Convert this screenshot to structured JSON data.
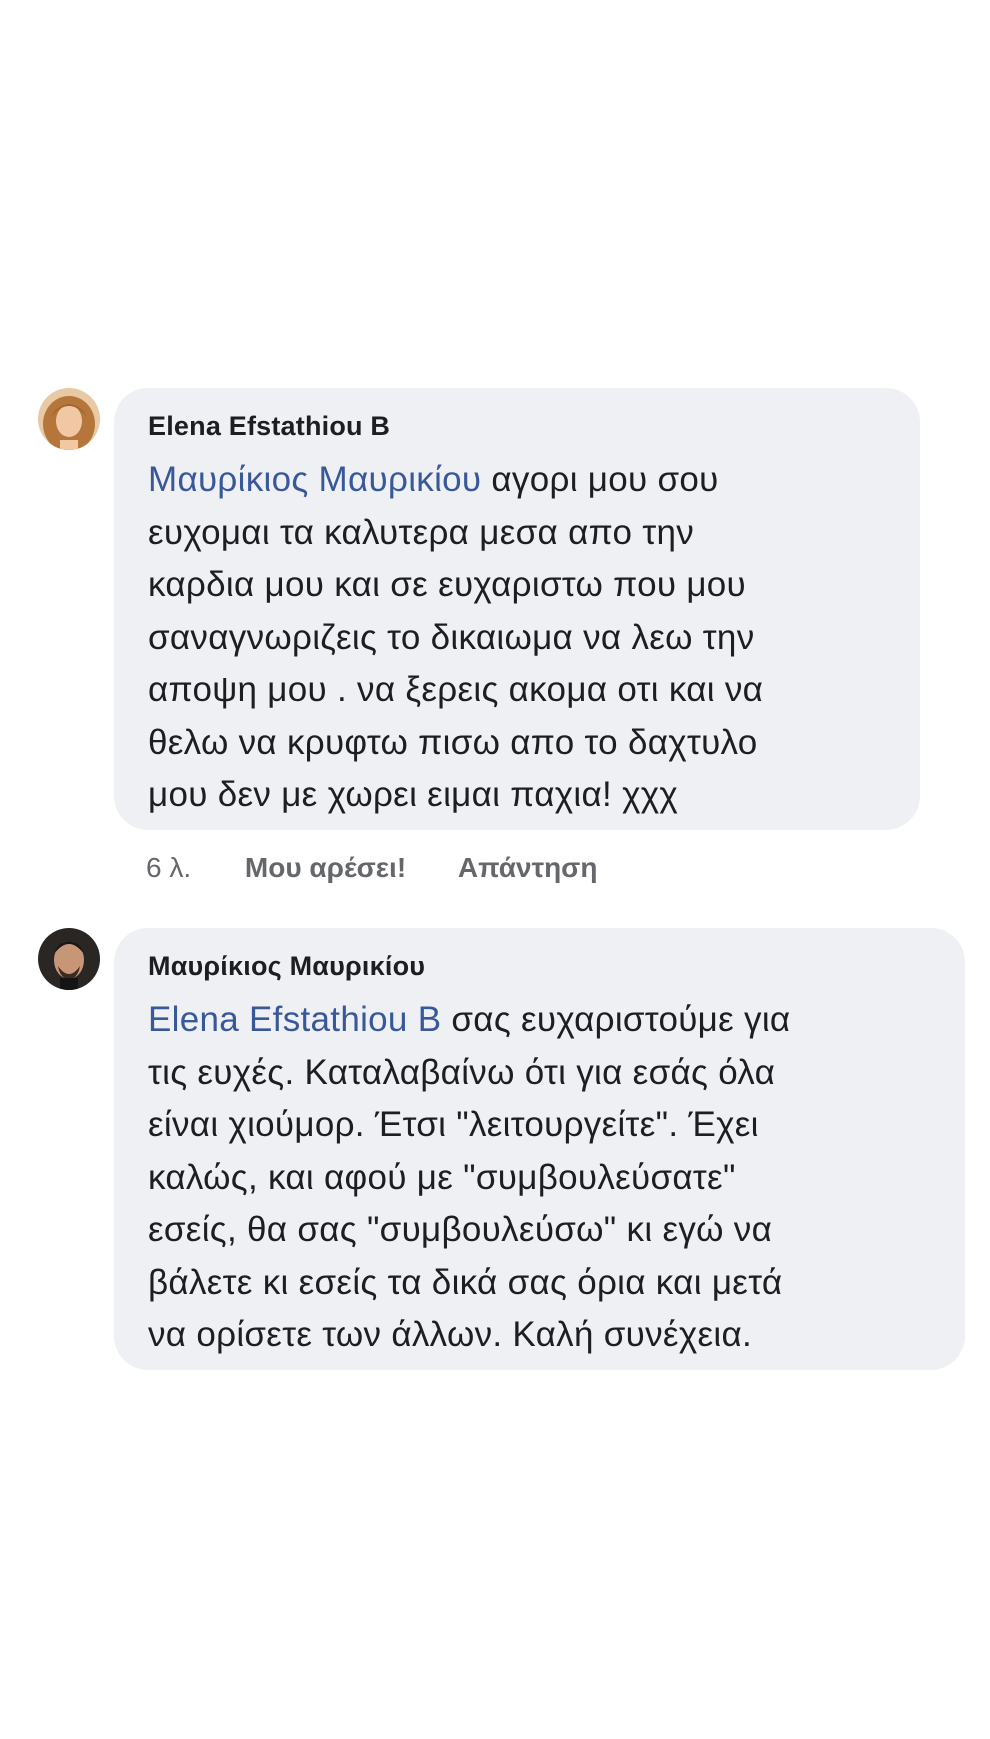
{
  "comments": [
    {
      "author": "Elena Efstathiou B",
      "mention": "Μαυρίκιος Μαυρικίου",
      "lines": [
        " αγορι μου σου",
        "ευχομαι τα καλυτερα μεσα απο την",
        "καρδια μου και σε ευχαριστω που μου",
        "σαναγνωριζεις το δικαιωμα να λεω την",
        "αποψη μου . να ξερεις ακομα οτι και να",
        "θελω να κρυφτω πισω απο το δαχτυλο",
        "μου δεν με χωρει ειμαι παχια! χχχ"
      ],
      "time": "6 λ.",
      "like_label": "Μου αρέσει!",
      "reply_label": "Απάντηση"
    },
    {
      "author": "Μαυρίκιος Μαυρικίου",
      "mention": "Elena Efstathiou B",
      "lines": [
        " σας ευχαριστούμε για",
        "τις ευχές. Καταλαβαίνω ότι για εσάς όλα",
        "είναι χιούμορ. Έτσι \"λειτουργείτε\". Έχει",
        "καλώς, και αφού με \"συμβουλεύσατε\"",
        "εσείς, θα σας \"συμβουλεύσω\" κι εγώ να",
        "βάλετε κι εσείς τα δικά σας όρια και μετά",
        "να ορίσετε των άλλων. Καλή συνέχεια."
      ]
    }
  ],
  "colors": {
    "bubble": "#eef0f4",
    "mention": "#385898",
    "meta": "#65676b"
  }
}
